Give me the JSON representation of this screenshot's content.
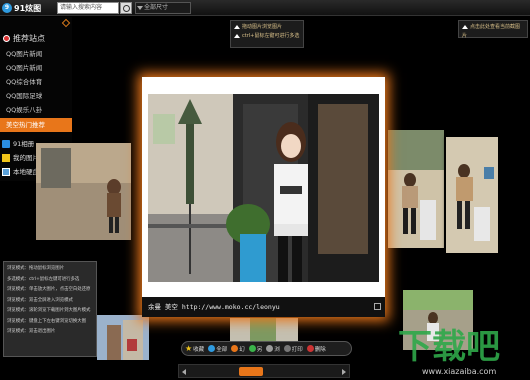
{
  "app": {
    "title": "91炫图"
  },
  "search": {
    "value": "请输入搜索内容"
  },
  "size_filter": {
    "selected": "全部尺寸"
  },
  "sidebar": {
    "header": "推荐站点",
    "items": [
      {
        "label": "QQ图片新闻"
      },
      {
        "label": "QQ图片新闻"
      },
      {
        "label": "QQ综合体育"
      },
      {
        "label": "QQ国际足球"
      },
      {
        "label": "QQ娱乐八卦"
      },
      {
        "label": "美空热门推荐"
      }
    ],
    "bottom": [
      {
        "label": "91相册",
        "icon": "album-icon"
      },
      {
        "label": "我的图片收藏",
        "icon": "star-icon"
      },
      {
        "label": "本地硬盘",
        "icon": "disk-icon"
      }
    ]
  },
  "tooltips": {
    "center": [
      "拖动图片浏览图片",
      "ctrl+鼠标左键可进行多选"
    ],
    "right": "点击此处查看当前截图片"
  },
  "main_photo": {
    "caption": "余曼 美空 http://www.moko.cc/leonyu"
  },
  "help_panel": {
    "lines": [
      "浏览模式：拖动鼠标浏览图片",
      "多选模式：ctrl+鼠标左键可进行多选",
      "浏览模式：单击放大图片，点击空白处还原",
      "浏览模式：双击全屏进入浏览模式",
      "浏览模式：滚轮浏览下载图片到大图片模式",
      "浏览模式：键盘上下左右键浏览切换大图",
      "浏览模式：双击退出图片"
    ]
  },
  "toolbar": {
    "items": [
      {
        "label": "收藏"
      },
      {
        "label": "全部"
      },
      {
        "label": "幻"
      },
      {
        "label": "另"
      },
      {
        "label": "浏"
      },
      {
        "label": "打印"
      },
      {
        "label": "删除"
      }
    ]
  },
  "watermark": {
    "text": "www.xiazaiba.com"
  },
  "colors": {
    "accent": "#e8761a",
    "brand_blue": "#2f9be0"
  }
}
